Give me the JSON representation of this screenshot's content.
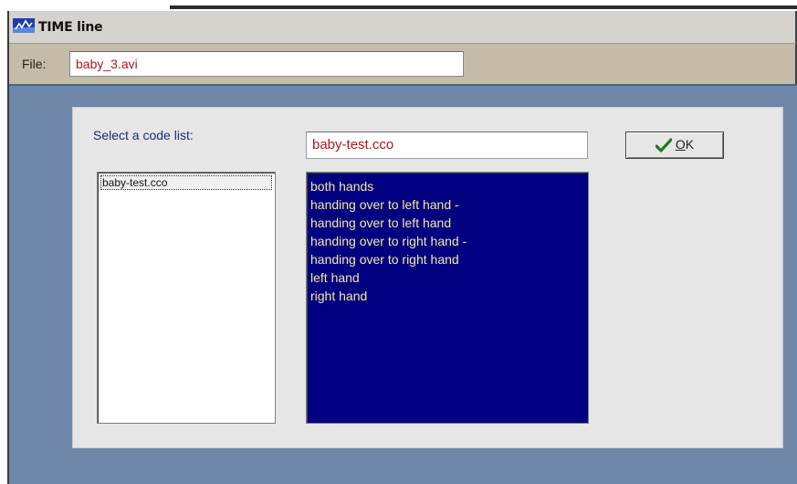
{
  "window": {
    "title": "TIME line"
  },
  "file_bar": {
    "label": "File:",
    "value": "baby_3.avi"
  },
  "code_list_panel": {
    "select_label": "Select a code list:",
    "selected_code_list": "baby-test.cco",
    "ok_button": {
      "mnemonic": "O",
      "rest": "K",
      "icon": "check-icon"
    },
    "available_lists": [
      "baby-test.cco"
    ],
    "codes": [
      "both hands",
      "handing over to left hand -",
      "handing over to left hand",
      "handing over to right hand -",
      "handing over to right hand",
      "left hand",
      "right hand"
    ]
  },
  "colors": {
    "desktop": "#6e86a8",
    "list_background": "#000080",
    "list_text": "#f6e8a0",
    "field_text": "#b01818",
    "check": "#1f7a1f"
  }
}
